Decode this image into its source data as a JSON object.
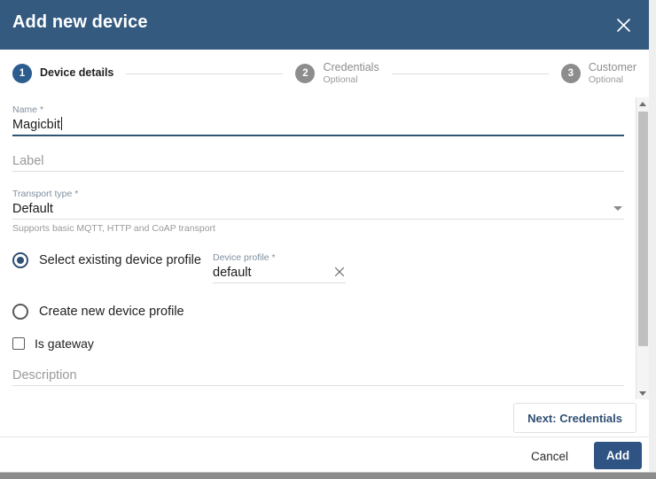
{
  "dialog": {
    "title": "Add new device",
    "close_icon": "close-icon"
  },
  "stepper": {
    "steps": [
      {
        "number": "1",
        "label": "Device details",
        "optional": "",
        "state": "active"
      },
      {
        "number": "2",
        "label": "Credentials",
        "optional": "Optional",
        "state": "inactive"
      },
      {
        "number": "3",
        "label": "Customer",
        "optional": "Optional",
        "state": "inactive"
      }
    ]
  },
  "form": {
    "name": {
      "label": "Name",
      "required_mark": "*",
      "value": "Magicbit"
    },
    "label_field": {
      "placeholder": "Label",
      "value": ""
    },
    "transport_type": {
      "label": "Transport type",
      "required_mark": "*",
      "value": "Default",
      "hint": "Supports basic MQTT, HTTP and CoAP transport",
      "dropdown_icon": "chevron-down-icon"
    },
    "profile_mode": {
      "select_existing_label": "Select existing device profile",
      "create_new_label": "Create new device profile",
      "selected": "select_existing"
    },
    "device_profile": {
      "label": "Device profile",
      "required_mark": "*",
      "value": "default",
      "clear_icon": "clear-icon"
    },
    "is_gateway": {
      "label": "Is gateway",
      "checked": false
    },
    "description": {
      "placeholder": "Description",
      "value": ""
    }
  },
  "actions": {
    "next_label": "Next: Credentials",
    "cancel_label": "Cancel",
    "add_label": "Add"
  },
  "colors": {
    "header_bg": "#345a80",
    "accent": "#2f5382",
    "step_active": "#2d5d8f",
    "step_inactive": "#8d8d8d",
    "label_muted": "#7f8fa0"
  }
}
